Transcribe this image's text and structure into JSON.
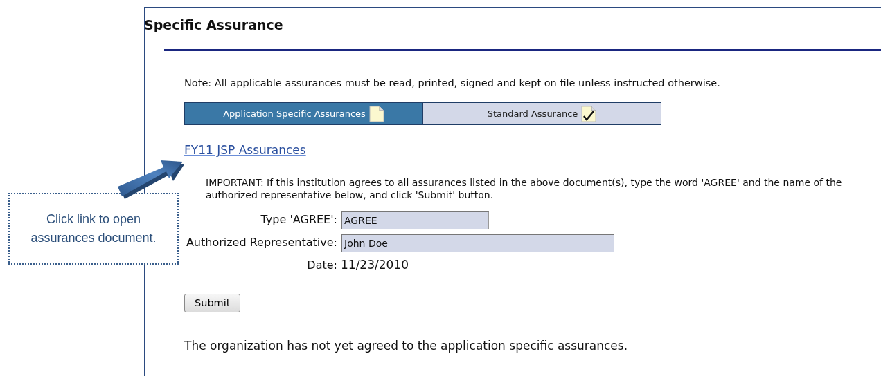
{
  "page": {
    "title": "Specific Assurance",
    "note": "Note: All applicable assurances must be read, printed, signed and kept on file unless instructed otherwise."
  },
  "tabs": [
    {
      "label": "Application Specific Assurances",
      "selected": true,
      "checked": false
    },
    {
      "label": "Standard Assurance",
      "selected": false,
      "checked": true
    }
  ],
  "document_link": "FY11 JSP Assurances",
  "instructions": "IMPORTANT: If this institution agrees to all assurances listed in the above document(s), type the word 'AGREE' and the name of the authorized representative below, and click 'Submit' button.",
  "form": [
    {
      "kind": "input",
      "label": "Type 'AGREE':",
      "value": "AGREE"
    },
    {
      "kind": "input",
      "label": "Authorized Representative:",
      "value": "John Doe"
    },
    {
      "kind": "text",
      "label": "Date:",
      "value": "11/23/2010"
    }
  ],
  "submit_button": "Submit",
  "status": "The organization has not yet agreed to the application specific assurances.",
  "callout": {
    "text": "Click link to open assurances document."
  }
}
